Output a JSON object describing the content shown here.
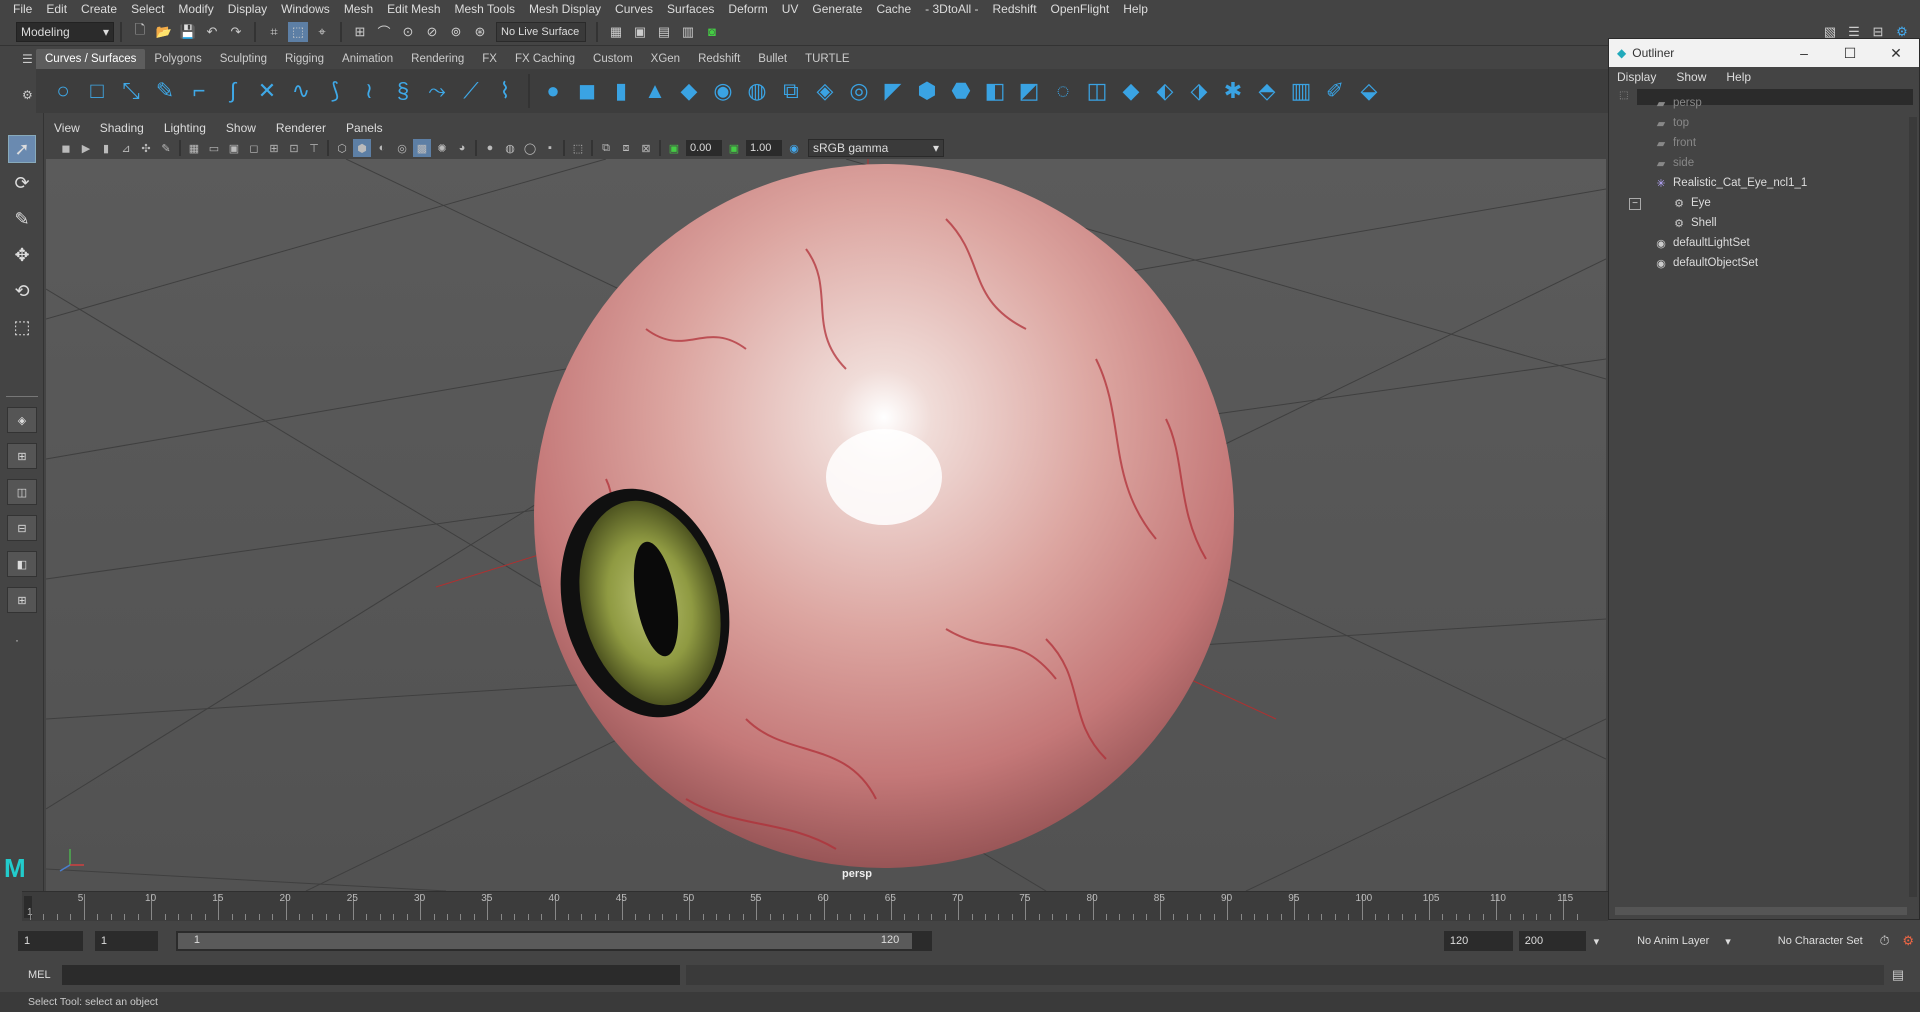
{
  "menubar": [
    "File",
    "Edit",
    "Create",
    "Select",
    "Modify",
    "Display",
    "Windows",
    "Mesh",
    "Edit Mesh",
    "Mesh Tools",
    "Mesh Display",
    "Curves",
    "Surfaces",
    "Deform",
    "UV",
    "Generate",
    "Cache",
    "- 3DtoAll -",
    "Redshift",
    "OpenFlight",
    "Help"
  ],
  "statusline": {
    "mode": "Modeling",
    "live_surface": "No Live Surface"
  },
  "shelf_tabs": [
    "Curves / Surfaces",
    "Polygons",
    "Sculpting",
    "Rigging",
    "Animation",
    "Rendering",
    "FX",
    "FX Caching",
    "Custom",
    "XGen",
    "Redshift",
    "Bullet",
    "TURTLE"
  ],
  "panel_menu": [
    "View",
    "Shading",
    "Lighting",
    "Show",
    "Renderer",
    "Panels"
  ],
  "panel_tools": {
    "exposure": "0.00",
    "gamma": "1.00",
    "color_space": "sRGB gamma"
  },
  "viewport": {
    "camera_label": "persp"
  },
  "outliner": {
    "title": "Outliner",
    "menu": [
      "Display",
      "Show",
      "Help"
    ],
    "items": [
      {
        "label": "persp",
        "dim": true
      },
      {
        "label": "top",
        "dim": true
      },
      {
        "label": "front",
        "dim": true
      },
      {
        "label": "side",
        "dim": true
      },
      {
        "label": "Realistic_Cat_Eye_ncl1_1",
        "dim": false
      },
      {
        "label": "Eye",
        "dim": false
      },
      {
        "label": "Shell",
        "dim": false
      },
      {
        "label": "defaultLightSet",
        "dim": false
      },
      {
        "label": "defaultObjectSet",
        "dim": false
      }
    ]
  },
  "timeline": {
    "current_frame": "1",
    "ticks": [
      "5",
      "10",
      "15",
      "20",
      "25",
      "30",
      "35",
      "40",
      "45",
      "50",
      "55",
      "60",
      "65",
      "70",
      "75",
      "80",
      "85",
      "90",
      "95",
      "100",
      "105",
      "110",
      "115"
    ]
  },
  "range": {
    "start": "1",
    "anim_start": "1",
    "range_start": "1",
    "range_end": "120",
    "end": "120",
    "anim_end": "200",
    "anim_layer": "No Anim Layer",
    "char_set": "No Character Set"
  },
  "cmdline": {
    "label": "MEL"
  },
  "helpline": {
    "text": "Select Tool: select an object"
  }
}
